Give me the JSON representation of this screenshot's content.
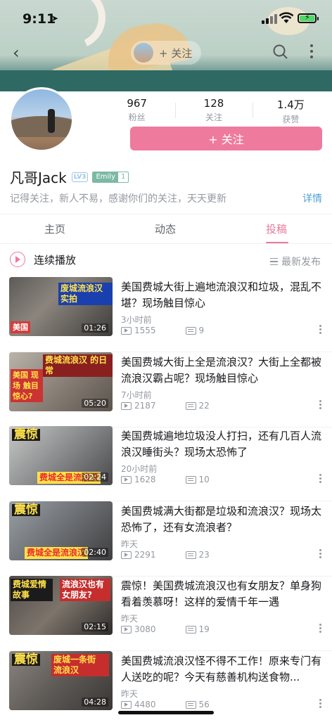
{
  "status_bar": {
    "time": "9:11"
  },
  "nav": {
    "follow_label": "+ 关注"
  },
  "profile": {
    "stats": [
      {
        "value": "967",
        "label": "粉丝"
      },
      {
        "value": "128",
        "label": "关注"
      },
      {
        "value": "1.4万",
        "label": "获赞"
      }
    ],
    "follow_button": "+ 关注",
    "name": "凡哥Jack",
    "level_badge": "LV3",
    "medal_name": "Emily",
    "medal_level": "1",
    "signature": "记得关注，新人不易，感谢你们的关注，天天更新",
    "detail_link": "详情"
  },
  "tabs": [
    {
      "label": "主页",
      "active": false
    },
    {
      "label": "动态",
      "active": false
    },
    {
      "label": "投稿",
      "active": true
    }
  ],
  "playlist": {
    "continuous_label": "连续播放",
    "sort_label": "最新发布"
  },
  "videos": [
    {
      "title": "美国费城大街上遍地流浪汉和垃圾，混乱不堪？现场触目惊心",
      "time": "3小时前",
      "views": "1555",
      "danmaku": "9",
      "duration": "01:26",
      "thumb_text": "废城流浪汉 实拍",
      "thumb_sub": "美国"
    },
    {
      "title": "美国费城大街上全是流浪汉？大街上全都被流浪汉霸占呢？现场触目惊心",
      "time": "7小时前",
      "views": "2187",
      "danmaku": "22",
      "duration": "05:20",
      "thumb_text": "费城流浪汉 的日常",
      "thumb_sub": "美国 现场 触目惊心?"
    },
    {
      "title": "美国费城遍地垃圾没人打扫，还有几百人流浪汉睡街头？现场太恐怖了",
      "time": "20小时前",
      "views": "1628",
      "danmaku": "10",
      "duration": "02:24",
      "thumb_text": "震惊",
      "thumb_sub": "费城全是流浪汉"
    },
    {
      "title": "美国费城满大街都是垃圾和流浪汉？现场太恐怖了，还有女流浪者？",
      "time": "昨天",
      "views": "2291",
      "danmaku": "23",
      "duration": "02:40",
      "thumb_text": "震惊",
      "thumb_sub": "费城全是流浪汉"
    },
    {
      "title": "震惊！美国费城流浪汉也有女朋友？单身狗看着羡慕呀！这样的爱情千年一遇",
      "time": "昨天",
      "views": "3080",
      "danmaku": "19",
      "duration": "02:15",
      "thumb_text": "费城爱情 故事",
      "thumb_sub": "流浪汉也有 女朋友?"
    },
    {
      "title": "美国费城流浪汉怪不得不工作！原来专门有人送吃的呢？今天有慈善机构送食物...",
      "time": "昨天",
      "views": "4480",
      "danmaku": "56",
      "duration": "04:28",
      "thumb_text": "震惊",
      "thumb_sub": "废城一条街 流浪汉"
    }
  ]
}
